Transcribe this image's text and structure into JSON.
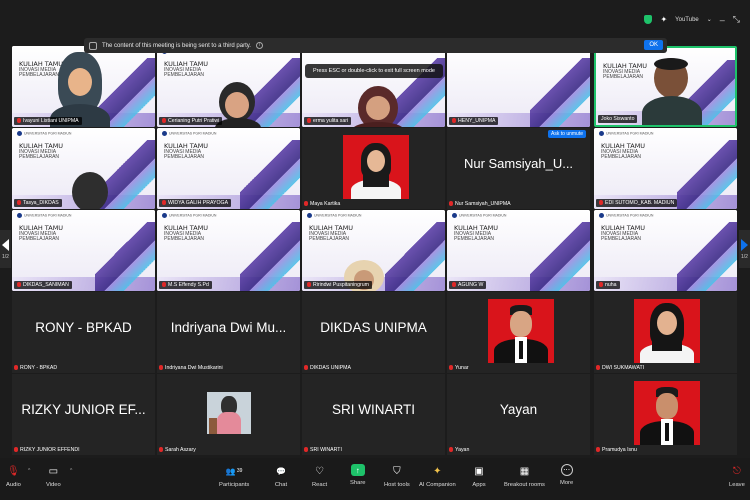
{
  "topbar": {
    "youtube_label": "YouTube",
    "youtube_caret": "⌄",
    "sparkle": "✦"
  },
  "notice": {
    "text": "The content of this meeting is being sent to a third party.",
    "info": "i",
    "ok_label": "OK"
  },
  "fullscreen_hint": "Press ESC or double-click to exit full screen mode",
  "slide": {
    "university": "UNIVERSITAS PGRI MADIUN",
    "title": "KULIAH TAMU",
    "subtitle": "INOVASI MEDIA\nPEMBELAJARAN"
  },
  "ask_to_unmute": "Ask to unmute",
  "pager": {
    "left": "1/2",
    "right": "1/2"
  },
  "participants": {
    "r1": [
      "Ivayuni Listiani UNIPMA",
      "Cerianing Putri Pratiwi",
      "erma yulita sari",
      "HENY_UNIPMA",
      "Joko Siswanto"
    ],
    "r2": [
      "Tasya_DIKDAS",
      "WIDYA GALIH PRAYOGA",
      "Maya Kartika",
      "Nur Samsiyah_UNIPMA",
      "EDI SUTOMO_KAB. MADIUN"
    ],
    "r2_big": "Nur Samsiyah_U...",
    "r3": [
      "DIKDAS_SANIMAN",
      "M.S Effendy S.Pd",
      "Ririndwi Puspitaningrum",
      "AGUNG W",
      "nuha"
    ],
    "r4": [
      "RONY - BPKAD",
      "Indriyana Dwi Mustikarini",
      "DIKDAS UNIPMA",
      "Yunar",
      "DWI SUKMAWATI"
    ],
    "r4_big": [
      "RONY - BPKAD",
      "Indriyana Dwi Mu...",
      "DIKDAS UNIPMA"
    ],
    "r5": [
      "RIZKY JUNIOR EFFENDI",
      "Sarah Aszary",
      "SRI WINARTI",
      "Yayan",
      "Pramudya Isnu"
    ],
    "r5_big": [
      "RIZKY JUNIOR EF...",
      "SRI WINARTI",
      "Yayan"
    ]
  },
  "toolbar": {
    "audio": "Audio",
    "video": "Video",
    "participants": "Participants",
    "participants_count": "39",
    "chat": "Chat",
    "react": "React",
    "share": "Share",
    "host_tools": "Host tools",
    "ai_companion": "AI Companion",
    "apps": "Apps",
    "breakout_rooms": "Breakout rooms",
    "more": "More",
    "leave": "Leave",
    "icons": {
      "audio": "🎙",
      "video": "▭",
      "participants": "👥",
      "chat": "💬",
      "react": "♡",
      "share": "↑",
      "host_tools": "⛉",
      "ai_companion": "✦",
      "apps": "▣",
      "breakout_rooms": "▦",
      "more": "⋯",
      "leave": "⎋"
    },
    "caret": "^"
  },
  "colors": {
    "accent_blue": "#0e72ed",
    "share_green": "#1ec26a",
    "muted_red": "#e02828",
    "photo_red": "#d9141b",
    "slide_purple": "#5b3fa6"
  }
}
